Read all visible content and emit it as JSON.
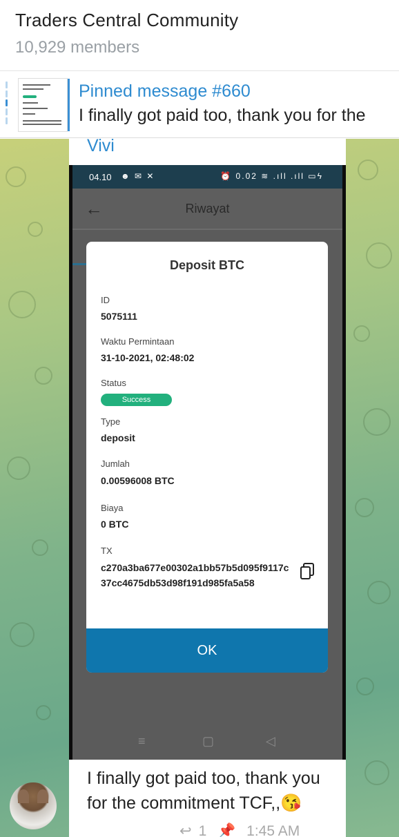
{
  "header": {
    "title": "Traders Central Community",
    "members": "10,929 members"
  },
  "pinned": {
    "title": "Pinned message #660",
    "text": "I finally got paid too, thank you for the"
  },
  "message": {
    "sender": "Vivi",
    "caption": "I finally got paid too, thank you for the commitment TCF,,😘",
    "reply_icon": "reply-icon",
    "replies": "1",
    "pin_icon": "pin-icon",
    "time": "1:45 AM"
  },
  "screenshot": {
    "status_time": "04.10",
    "status_left_icons": "☻ ✉ ✕",
    "status_right_icons": "⏰ 0.02 ≋ .ıll .ıll ▭ϟ",
    "app_title": "Riwayat",
    "dialog": {
      "title": "Deposit BTC",
      "id_label": "ID",
      "id_value": "5075111",
      "time_label": "Waktu Permintaan",
      "time_value": "31-10-2021, 02:48:02",
      "status_label": "Status",
      "status_value": "Success",
      "type_label": "Type",
      "type_value": "deposit",
      "amount_label": "Jumlah",
      "amount_value": "0.00596008 BTC",
      "fee_label": "Biaya",
      "fee_value": "0 BTC",
      "tx_label": "TX",
      "tx_value": "c270a3ba677e00302a1bb57b5d095f9117c37cc4675db53d98f191d985fa5a58",
      "ok_label": "OK"
    },
    "nav": [
      "≡",
      "▢",
      "◁"
    ]
  },
  "colors": {
    "accent": "#2e8bd0",
    "success": "#22b07d",
    "ok_button": "#0f76ad"
  }
}
